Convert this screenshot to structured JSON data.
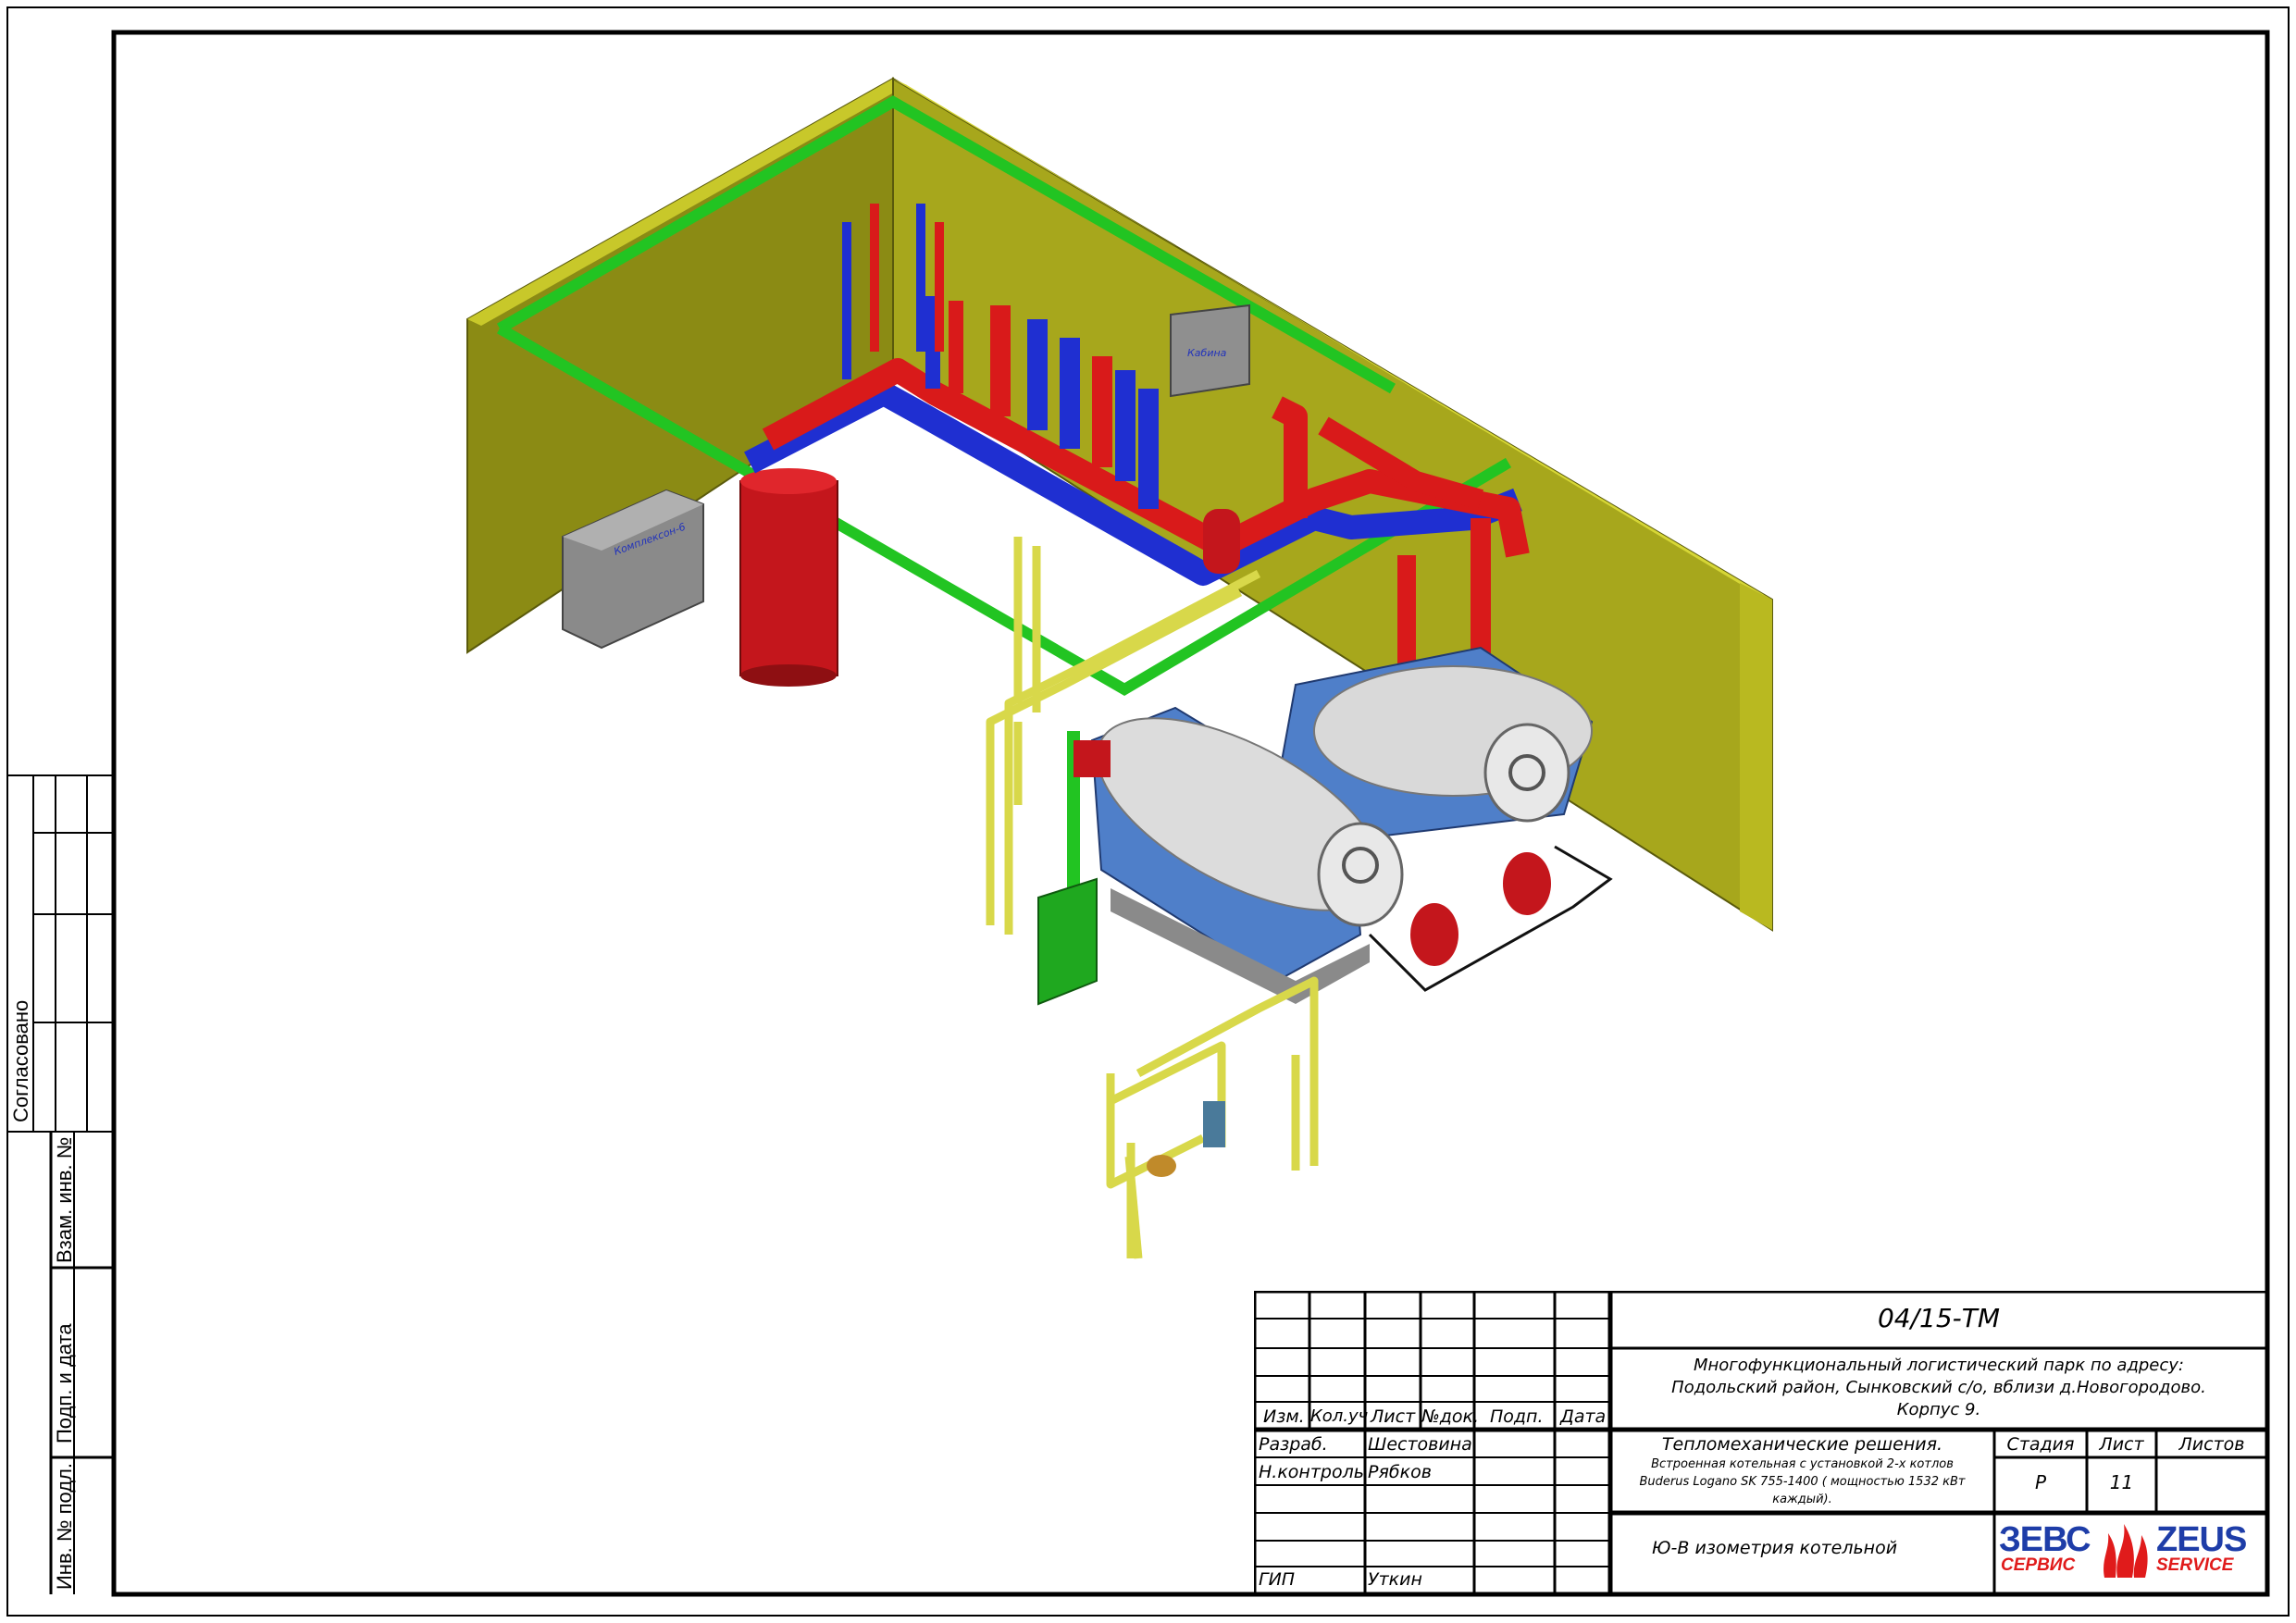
{
  "side_stamps": {
    "agreed": "Согласовано",
    "replace_inv": "Взам. инв. №",
    "sign_date": "Подп. и дата",
    "inv_original": "Инв. № подл."
  },
  "equipment_labels": {
    "control_panel": "Кабина",
    "water_treatment": "Комплексон-6"
  },
  "title_block": {
    "doc_code": "04/15-ТМ",
    "object_line1": "Многофункциональный логистический парк по адресу:",
    "object_line2": "Подольский район, Сынковский с/о, вблизи д.Новогородово.",
    "object_line3": "Корпус 9.",
    "section": "Тепломеханические решения.",
    "desc_line1": "Встроенная котельная с установкой 2-х котлов",
    "desc_line2": "Buderus Logano SK 755-1400 ( мощностью 1532 кВт",
    "desc_line3": "каждый).",
    "sheet_title": "Ю-В изометрия котельной",
    "headers": {
      "izm": "Изм.",
      "kol": "Кол.уч",
      "list": "Лист",
      "ndok": "№док.",
      "podp": "Подп.",
      "data": "Дата",
      "stadia": "Стадия",
      "list2": "Лист",
      "listov": "Листов"
    },
    "stadia_value": "Р",
    "list_value": "11",
    "listov_value": "",
    "roles": [
      {
        "role": "Разраб.",
        "name": "Шестовина"
      },
      {
        "role": "Н.контроль",
        "name": "Рябков"
      },
      {
        "role": "ГИП",
        "name": "Уткин"
      }
    ],
    "logo": {
      "left_top": "ЗЕВС",
      "left_bottom": "СЕРВИС",
      "right_top": "ZEUS",
      "right_bottom": "SERVICE",
      "blue": "#1e3da8",
      "red": "#e01b1b"
    }
  },
  "colors": {
    "wall": "#8b8b14",
    "wall_light": "#a7a71c",
    "wall_top": "#c8c82a",
    "hot_pipe": "#d91a1a",
    "cold_pipe": "#1f2fd1",
    "green_pipe": "#22c422",
    "gas_pipe": "#d8d84a"
  }
}
